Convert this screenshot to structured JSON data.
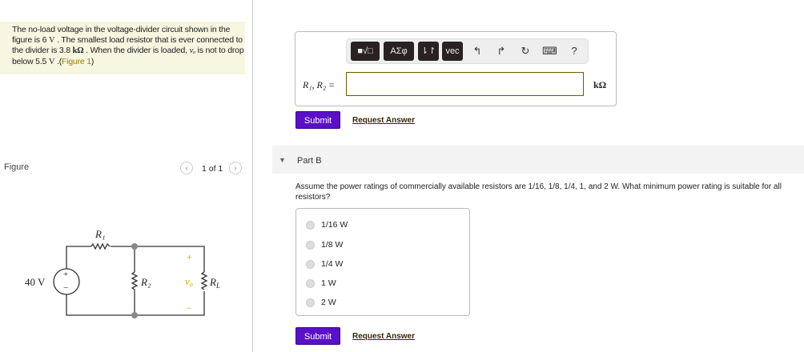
{
  "problem": {
    "t1": "The no-load voltage in the voltage-divider circuit shown in the figure is 6 ",
    "v1": "V",
    "t2": " . The smallest load resistor that is ever connected to the divider is 3.8 ",
    "u2": "kΩ",
    "t3": " . When the divider is loaded, ",
    "vo": "vₒ",
    "t4": " is not to drop below 5.5 ",
    "v4": "V",
    "t5": " .(",
    "link": "Figure 1",
    "t6": ")"
  },
  "figure": {
    "label": "Figure",
    "pager": "1 of 1",
    "prev": "‹",
    "next": "›",
    "circuit": {
      "source": "40 V",
      "r1": "R₁",
      "r2": "R₂",
      "rl": "R",
      "rl_sub": "L",
      "vo": "v",
      "vo_sub": "o",
      "plus": "+",
      "minus": "−",
      "src_plus": "+",
      "src_minus": "−"
    }
  },
  "partA": {
    "toolbar": {
      "templates": "■√□",
      "greek": "ΑΣφ",
      "arrows": "⇂↾",
      "vec": "vec",
      "undo": "↰",
      "redo": "↱",
      "reset": "↻",
      "keyboard": "⌨",
      "help": "?"
    },
    "label": "R₁, R₂ =",
    "input_value": "",
    "unit": "kΩ",
    "submit": "Submit",
    "request": "Request Answer"
  },
  "partB": {
    "toggle": "▼",
    "title": "Part B",
    "question": "Assume the power ratings of commercially available resistors are 1/16, 1/8, 1/4, 1, and 2 W. What minimum power rating is suitable for all resistors?",
    "options": [
      "1/16 W",
      "1/8 W",
      "1/4 W",
      "1 W",
      "2 W"
    ],
    "submit": "Submit",
    "request": "Request Answer"
  }
}
